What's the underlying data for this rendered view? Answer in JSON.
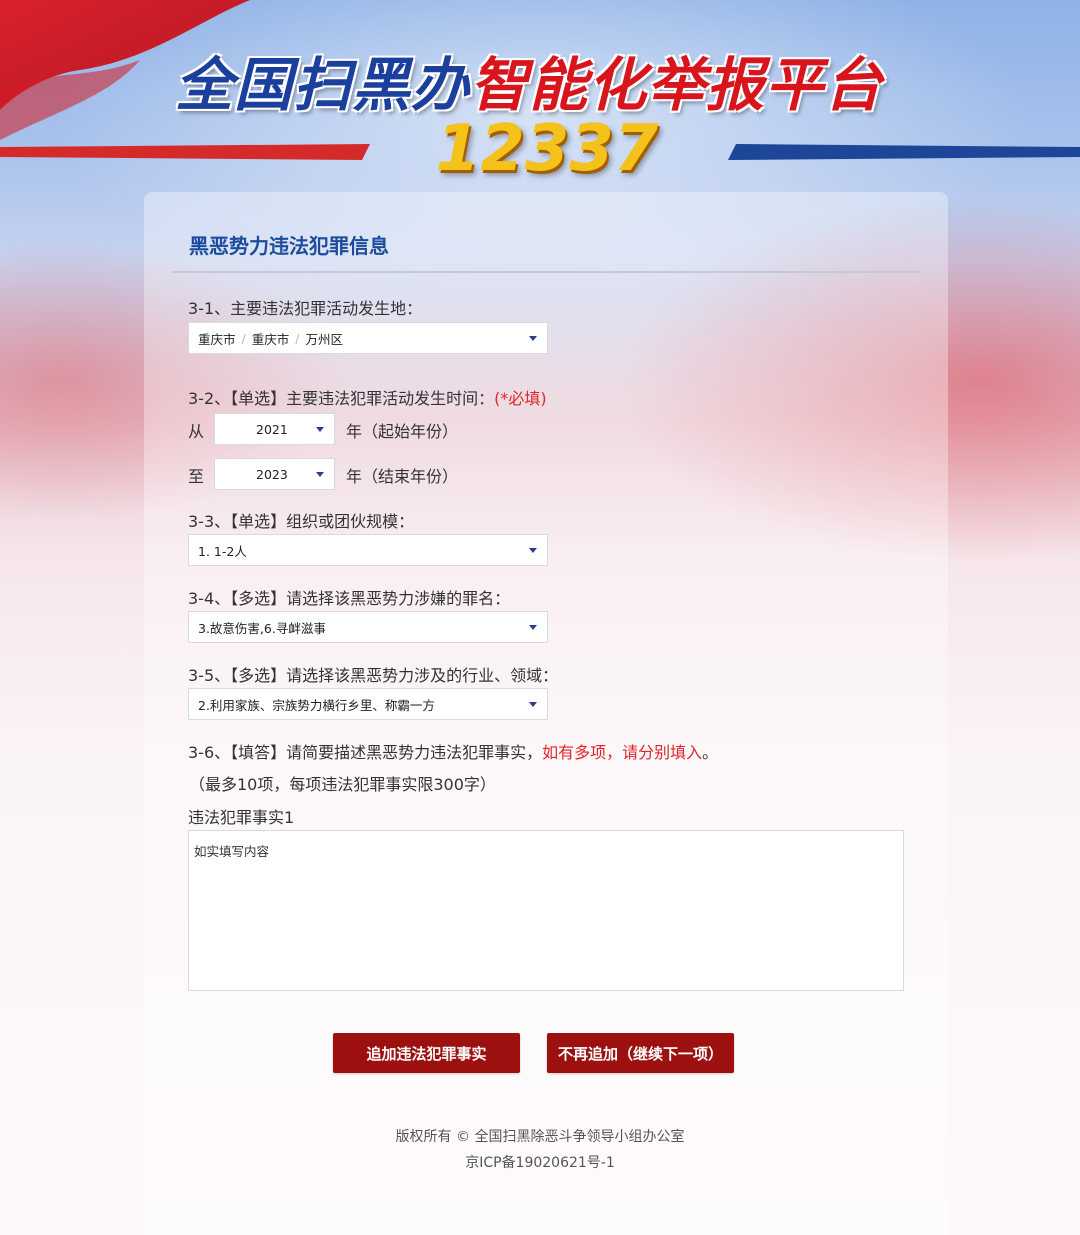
{
  "header": {
    "title_part1": "全国扫黑办",
    "title_part2": "智能化举报平台",
    "hotline": "12337"
  },
  "section": {
    "title": "黑恶势力违法犯罪信息"
  },
  "q31": {
    "label": "3-1、主要违法犯罪活动发生地：",
    "region": [
      "重庆市",
      "重庆市",
      "万州区"
    ]
  },
  "q32": {
    "label": "3-2、【单选】主要违法犯罪活动发生时间：",
    "required": "(*必填)",
    "from_label": "从",
    "from_value": "2021",
    "from_suffix": "年（起始年份）",
    "to_label": "至",
    "to_value": "2023",
    "to_suffix": "年（结束年份）"
  },
  "q33": {
    "label": "3-3、【单选】组织或团伙规模：",
    "value": "1. 1-2人"
  },
  "q34": {
    "label": "3-4、【多选】请选择该黑恶势力涉嫌的罪名：",
    "value": "3.故意伤害,6.寻衅滋事"
  },
  "q35": {
    "label": "3-5、【多选】请选择该黑恶势力涉及的行业、领域：",
    "value": "2.利用家族、宗族势力横行乡里、称霸一方"
  },
  "q36": {
    "label": "3-6、【填答】请简要描述黑恶势力违法犯罪事实，",
    "label_red": "如有多项，请分别填入",
    "label_end": "。",
    "note": "（最多10项，每项违法犯罪事实限300字）",
    "fact_label": "违法犯罪事实1",
    "placeholder": "如实填写内容"
  },
  "buttons": {
    "add": "追加违法犯罪事实",
    "next": "不再追加（继续下一项）"
  },
  "footer": {
    "copyright": "版权所有 © 全国扫黑除恶斗争领导小组办公室",
    "icp": "京ICP备19020621号-1"
  },
  "colors": {
    "accent_blue": "#1c4c9c",
    "button_red": "#9c1010",
    "required_red": "#e0262a",
    "hotline_gold": "#f5c21b"
  }
}
